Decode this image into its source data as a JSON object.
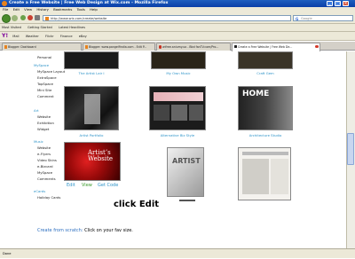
{
  "window": {
    "title": "Create a Free Website | Free Web Design at Wix.com - Mozilla Firefox",
    "min": "_",
    "max": "□",
    "close": "✕"
  },
  "menu": [
    "File",
    "Edit",
    "View",
    "History",
    "Bookmarks",
    "Tools",
    "Help"
  ],
  "nav": {
    "url": "http://www.wix.com/create/website",
    "search_placeholder": "Google",
    "search_logo": "G"
  },
  "bookmarks": [
    "Most Visited",
    "Getting Started",
    "Latest Headlines"
  ],
  "yahoo": {
    "logo": "Y!",
    "items": [
      "Mail",
      "Weather",
      "Flickr",
      "Finance",
      "eBay"
    ]
  },
  "tabs": [
    {
      "label": "Blogger: Dashboard"
    },
    {
      "label": "Blogger: www.pangelfindia.com - Edit P..."
    },
    {
      "label": "wifree.aniumy.uo - Bbd fanTV.com/Pro..."
    },
    {
      "label": "Create a Free Website | Free Web De...",
      "active": true
    }
  ],
  "sidebar": [
    {
      "t": "item",
      "label": "Personal"
    },
    {
      "t": "hdr",
      "label": "MySpace"
    },
    {
      "t": "item",
      "label": "MySpace Layout"
    },
    {
      "t": "item",
      "label": "ExtraSpace"
    },
    {
      "t": "item",
      "label": "TopSpace"
    },
    {
      "t": "item",
      "label": "Mini Site"
    },
    {
      "t": "item",
      "label": "Comment"
    },
    {
      "t": "hdr",
      "label": "Art"
    },
    {
      "t": "item",
      "label": "Website"
    },
    {
      "t": "item",
      "label": "Exhibition"
    },
    {
      "t": "item",
      "label": "Widget"
    },
    {
      "t": "hdr",
      "label": "Music"
    },
    {
      "t": "item",
      "label": "Website"
    },
    {
      "t": "item",
      "label": "e-Flyers"
    },
    {
      "t": "item",
      "label": "Video Skins"
    },
    {
      "t": "item",
      "label": "e-Bizcard"
    },
    {
      "t": "item",
      "label": "MySpace"
    },
    {
      "t": "item",
      "label": "Comments"
    },
    {
      "t": "hdr",
      "label": "eCards"
    },
    {
      "t": "item",
      "label": "Holiday Cards"
    }
  ],
  "gallery": {
    "row1": [
      "The Artist Lair I",
      "My Own Music",
      "Craft Gem"
    ],
    "row2": [
      "Artist Portfolio",
      "Alternative Biz Style",
      "Architecture Studio"
    ],
    "row3_texts": {
      "red": "Artist’s Website",
      "gray": "ARTIST",
      "arch": "HOME"
    },
    "edit_links": [
      "Edit",
      "View",
      "Get Code"
    ]
  },
  "annotation": "click Edit",
  "scratch": {
    "link": "Create from scratch:",
    "text": "Click on your fav size."
  },
  "status": "Done",
  "colors": {
    "accent": "#2d93c8",
    "edit_green": "#3a9a2a"
  }
}
